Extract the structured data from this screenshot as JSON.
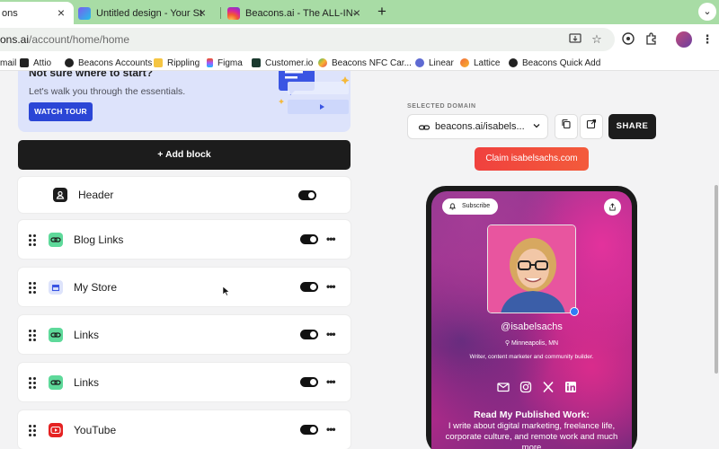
{
  "browser": {
    "tabs": [
      {
        "title": "ons",
        "active": true
      },
      {
        "title": "Untitled design - Your Story -",
        "active": false
      },
      {
        "title": "Beacons.ai - The ALL-IN-ONE",
        "active": false
      }
    ],
    "new_tab_label": "+",
    "tab_menu_label": "⌄",
    "url_host": "ons.ai",
    "url_path": "/account/home/home",
    "colors": {
      "tabstrip": "#a8dca5",
      "omnibox": "#eef1ee"
    }
  },
  "bookmarks": [
    {
      "label": "mail"
    },
    {
      "label": "Attio"
    },
    {
      "label": "Beacons Accounts"
    },
    {
      "label": "Rippling"
    },
    {
      "label": "Figma"
    },
    {
      "label": "Customer.io"
    },
    {
      "label": "Beacons NFC Car..."
    },
    {
      "label": "Linear"
    },
    {
      "label": "Lattice"
    },
    {
      "label": "Beacons Quick Add"
    }
  ],
  "editor": {
    "tour": {
      "heading": "Not sure where to start?",
      "subtitle": "Let's walk you through the essentials.",
      "button": "WATCH TOUR"
    },
    "add_block": "+ Add block",
    "blocks": [
      {
        "label": "Header",
        "icon": "person-icon",
        "enabled": true
      },
      {
        "label": "Blog Links",
        "icon": "link-icon",
        "enabled": true
      },
      {
        "label": "My Store",
        "icon": "store-icon",
        "enabled": true
      },
      {
        "label": "Links",
        "icon": "link-icon",
        "enabled": true
      },
      {
        "label": "Links",
        "icon": "link-icon",
        "enabled": true
      },
      {
        "label": "YouTube",
        "icon": "youtube-icon",
        "enabled": true
      }
    ],
    "more_label": "•••"
  },
  "preview": {
    "selected_domain_label": "SELECTED DOMAIN",
    "domain_value": "beacons.ai/isabels...",
    "share_button": "SHARE",
    "claim_button": "Claim isabelsachs.com",
    "subscribe": "Subscribe",
    "handle": "@isabelsachs",
    "location": "Minneapolis, MN",
    "bio": "Writer, content marketer and community builder.",
    "section_heading": "Read My Published Work:",
    "section_text": "I write about digital marketing, freelance life, corporate culture, and remote work and much more"
  }
}
